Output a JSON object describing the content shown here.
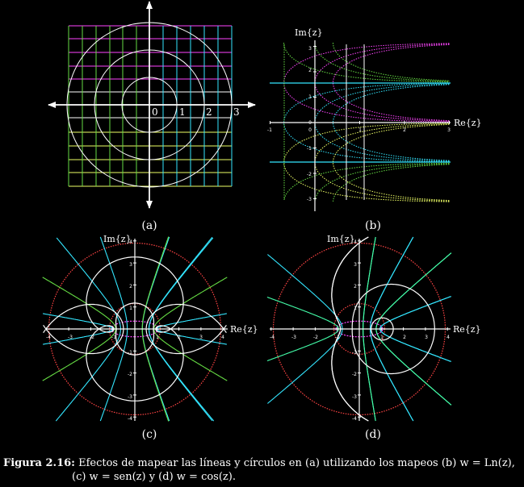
{
  "panels": {
    "a": {
      "label": "(a)",
      "axis_ticks": [
        "0",
        "1",
        "2",
        "3"
      ]
    },
    "b": {
      "label": "(b)",
      "x_axis_label": "Re{z}",
      "y_axis_label": "Im{z}",
      "x_ticks": [
        "-1",
        "0",
        "1",
        "2",
        "3"
      ],
      "y_ticks": [
        "3",
        "2",
        "1",
        "0",
        "-1",
        "-2",
        "-3"
      ]
    },
    "c": {
      "label": "(c)",
      "x_axis_label": "Re{z}",
      "y_axis_label": "Im{z}",
      "x_ticks": [
        "-4",
        "-3",
        "-2",
        "-1",
        "1",
        "2",
        "3",
        "4"
      ],
      "y_ticks": [
        "4",
        "3",
        "2",
        "1",
        "-1",
        "-2",
        "-3",
        "-4"
      ]
    },
    "d": {
      "label": "(d)",
      "x_axis_label": "Re{z}",
      "y_axis_label": "Im{z}",
      "x_ticks": [
        "-4",
        "-3",
        "-2",
        "-1",
        "1",
        "2",
        "3",
        "4"
      ],
      "y_ticks": [
        "4",
        "3",
        "2",
        "1",
        "-1",
        "-2",
        "-3",
        "-4"
      ]
    }
  },
  "caption": {
    "heading": "Figura 2.16:",
    "line1": "Efectos de mapear las líneas y círculos en (a) utilizando los mapeos (b) w = Ln(z),",
    "line2": "(c) w = sen(z) y (d) w = cos(z)."
  },
  "colors": {
    "background": "#000000",
    "white": "#ffffff",
    "magenta": "#ff44ff",
    "cyan": "#33e6ff",
    "yellow": "#eeff66",
    "green": "#66dd44",
    "red": "#ff4444",
    "spring_green": "#44ffaa"
  }
}
